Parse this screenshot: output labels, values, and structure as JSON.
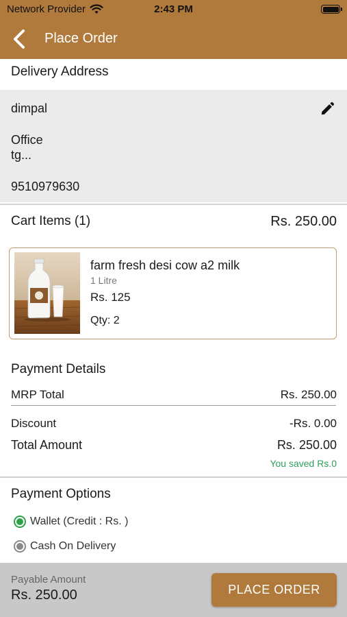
{
  "status_bar": {
    "carrier": "Network Provider",
    "time": "2:43 PM",
    "wifi_icon": "wifi-icon",
    "battery_icon": "battery-icon"
  },
  "nav": {
    "back_icon": "chevron-left-icon",
    "title": "Place Order"
  },
  "delivery": {
    "title": "Delivery Address",
    "name": "dimpal",
    "address_type": "Office",
    "address": "tg...",
    "phone": "9510979630",
    "edit_icon": "pencil-icon"
  },
  "cart": {
    "title": "Cart Items (1)",
    "total": "Rs. 250.00",
    "items": [
      {
        "name": "farm fresh desi cow a2 milk",
        "unit": "1 Litre",
        "price": "Rs. 125",
        "qty": "Qty: 2"
      }
    ]
  },
  "payment_details": {
    "title": "Payment Details",
    "mrp_label": "MRP Total",
    "mrp_value": "Rs. 250.00",
    "discount_label": "Discount",
    "discount_value": "-Rs. 0.00",
    "total_label": "Total Amount",
    "total_value": "Rs. 250.00",
    "saved": "You saved Rs.0"
  },
  "payment_options": {
    "title": "Payment Options",
    "options": [
      {
        "label": "Wallet (Credit : Rs. )",
        "selected": true
      },
      {
        "label": "Cash On Delivery",
        "selected": false
      }
    ]
  },
  "footer": {
    "payable_label": "Payable Amount",
    "payable_value": "Rs. 250.00",
    "button_label": "PLACE ORDER"
  },
  "colors": {
    "brand": "#b07a3c",
    "selected_radio": "#2ea24a",
    "saved_text": "#2e9e5a"
  }
}
